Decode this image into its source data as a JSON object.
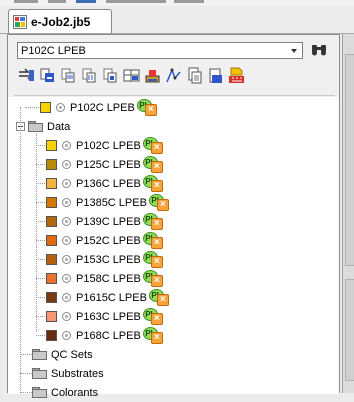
{
  "tab": {
    "label": "e-Job2.jb5"
  },
  "selector": {
    "value": "P102C LPEB"
  },
  "toolbar": {
    "icons": [
      "move-to-icon",
      "add-standard-icon",
      "duplicate-icon",
      "copy-icon",
      "paste-icon",
      "compare-icon",
      "measure-icon",
      "chart-icon",
      "report-icon",
      "new-doc-icon",
      "export-pdf-icon"
    ]
  },
  "tree": {
    "root": {
      "label": "P102C LPEB",
      "swatch": "#f7d100"
    },
    "data_folder": {
      "label": "Data"
    },
    "items": [
      {
        "label": "P102C LPEB",
        "swatch": "#f7d100"
      },
      {
        "label": "P125C LPEB",
        "swatch": "#b88a06"
      },
      {
        "label": "P136C LPEB",
        "swatch": "#f4b540"
      },
      {
        "label": "P1385C LPEB",
        "swatch": "#d47800"
      },
      {
        "label": "P139C LPEB",
        "swatch": "#b5680a"
      },
      {
        "label": "P152C LPEB",
        "swatch": "#e06a10"
      },
      {
        "label": "P153C LPEB",
        "swatch": "#b9600e"
      },
      {
        "label": "P158C LPEB",
        "swatch": "#e8742c"
      },
      {
        "label": "P1615C LPEB",
        "swatch": "#7a3b14"
      },
      {
        "label": "P163C LPEB",
        "swatch": "#f99671"
      },
      {
        "label": "P168C LPEB",
        "swatch": "#6a2a10"
      }
    ],
    "folders": [
      {
        "label": "QC Sets"
      },
      {
        "label": "Substrates"
      },
      {
        "label": "Colorants"
      }
    ]
  }
}
